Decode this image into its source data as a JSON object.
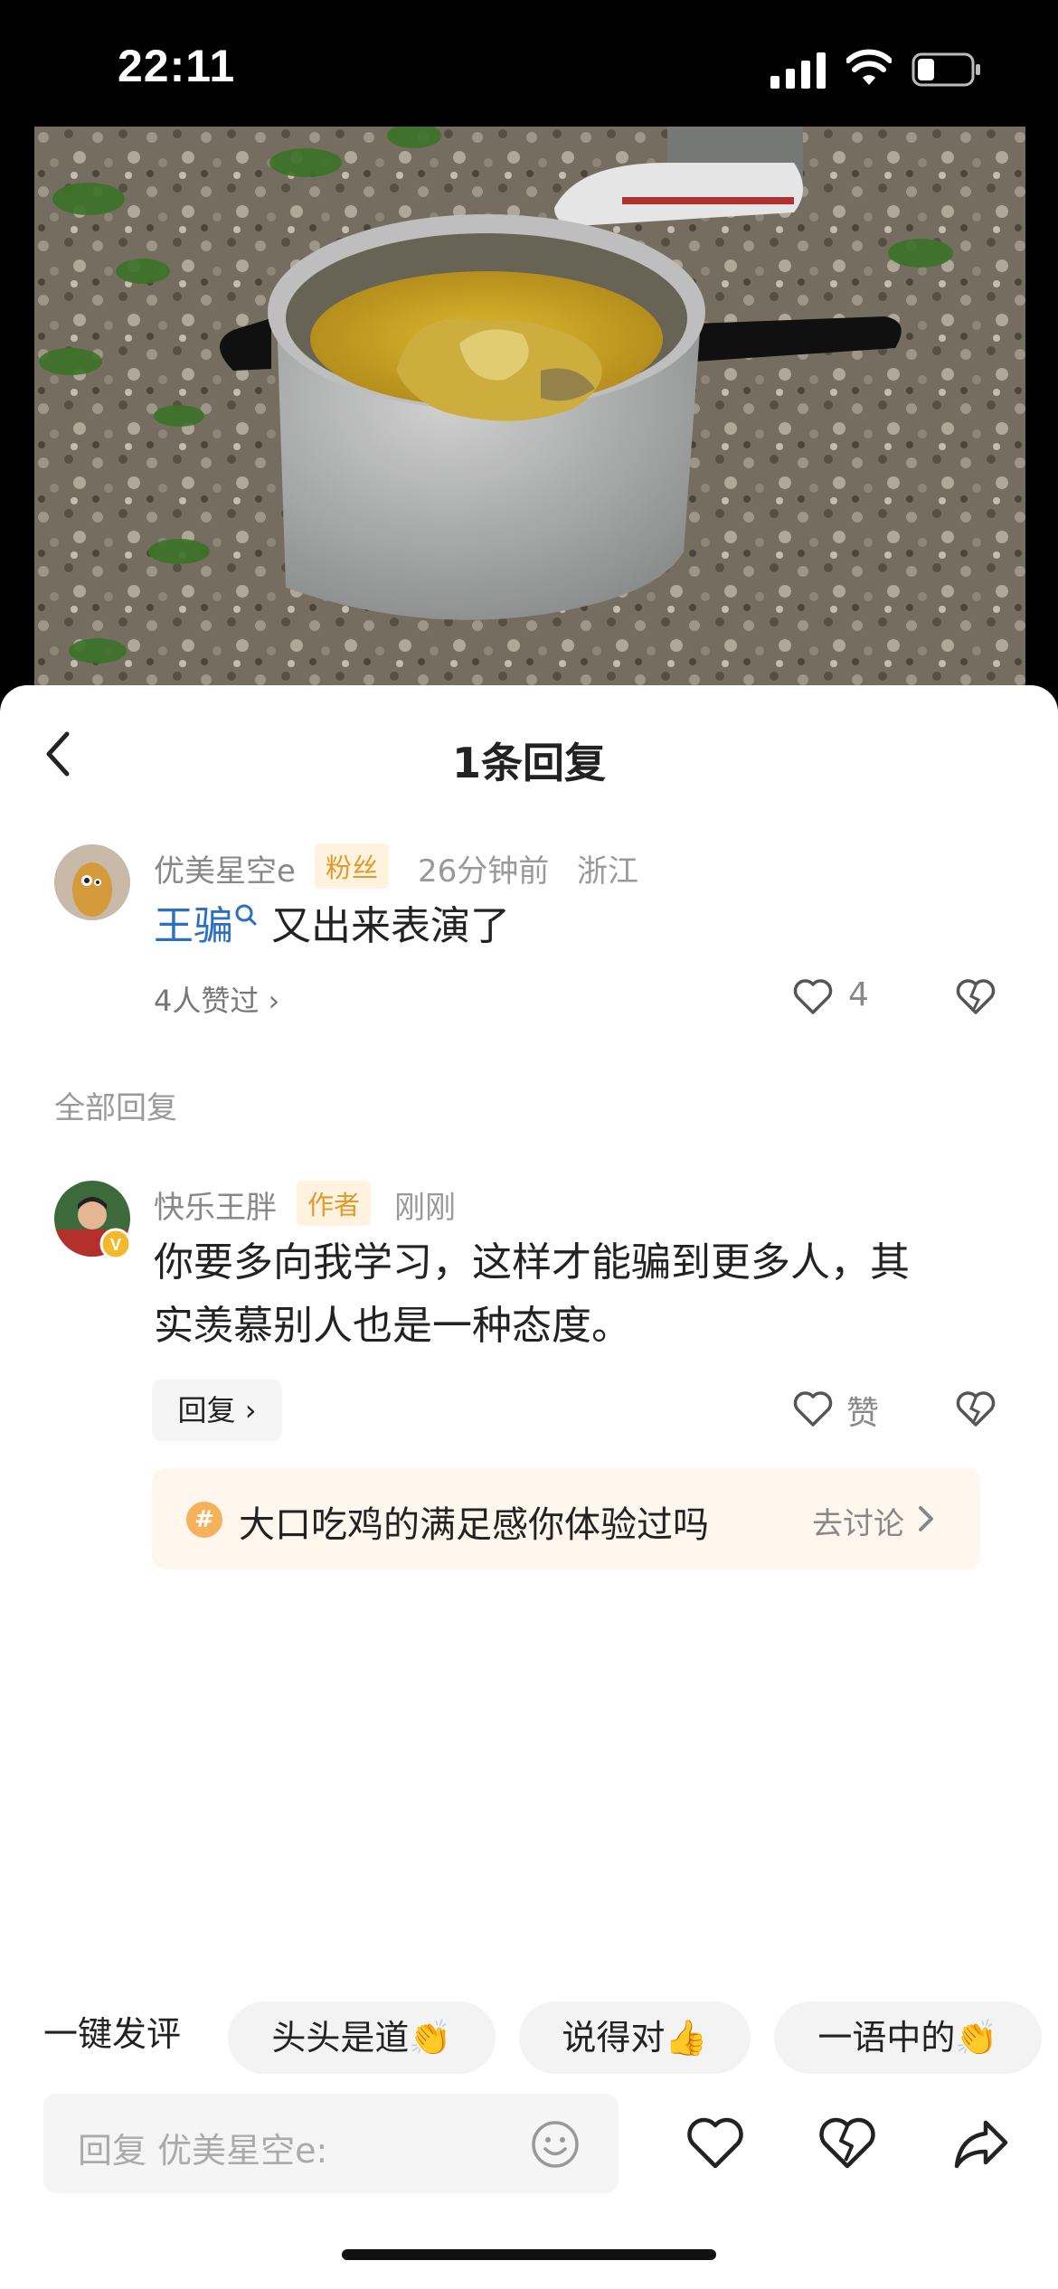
{
  "status_bar": {
    "time": "22:11"
  },
  "sheet": {
    "title": "1条回复"
  },
  "main_comment": {
    "author": "优美星空e",
    "badge": "粉丝",
    "time": "26分钟前",
    "location": "浙江",
    "keyword": "王骗",
    "text": "又出来表演了",
    "likers": "4人赞过",
    "like_count": "4"
  },
  "section_label": "全部回复",
  "reply": {
    "author": "快乐王胖",
    "badge": "作者",
    "time": "刚刚",
    "text_line1": "你要多向我学习，这样才能骗到更多人，其",
    "text_line2": "实羡慕别人也是一种态度。",
    "reply_button": "回复",
    "like_label": "赞"
  },
  "topic": {
    "text": "大口吃鸡的满足感你体验过吗",
    "action": "去讨论"
  },
  "quick_reply": {
    "label": "一键发评",
    "chips": [
      "头头是道👏",
      "说得对👍",
      "一语中的👏"
    ]
  },
  "input": {
    "placeholder": "回复 优美星空e:"
  },
  "colors": {
    "keyword": "#2a6fc2",
    "fan_badge": "#e09a2d",
    "topic_bg": "#fff7ee"
  }
}
